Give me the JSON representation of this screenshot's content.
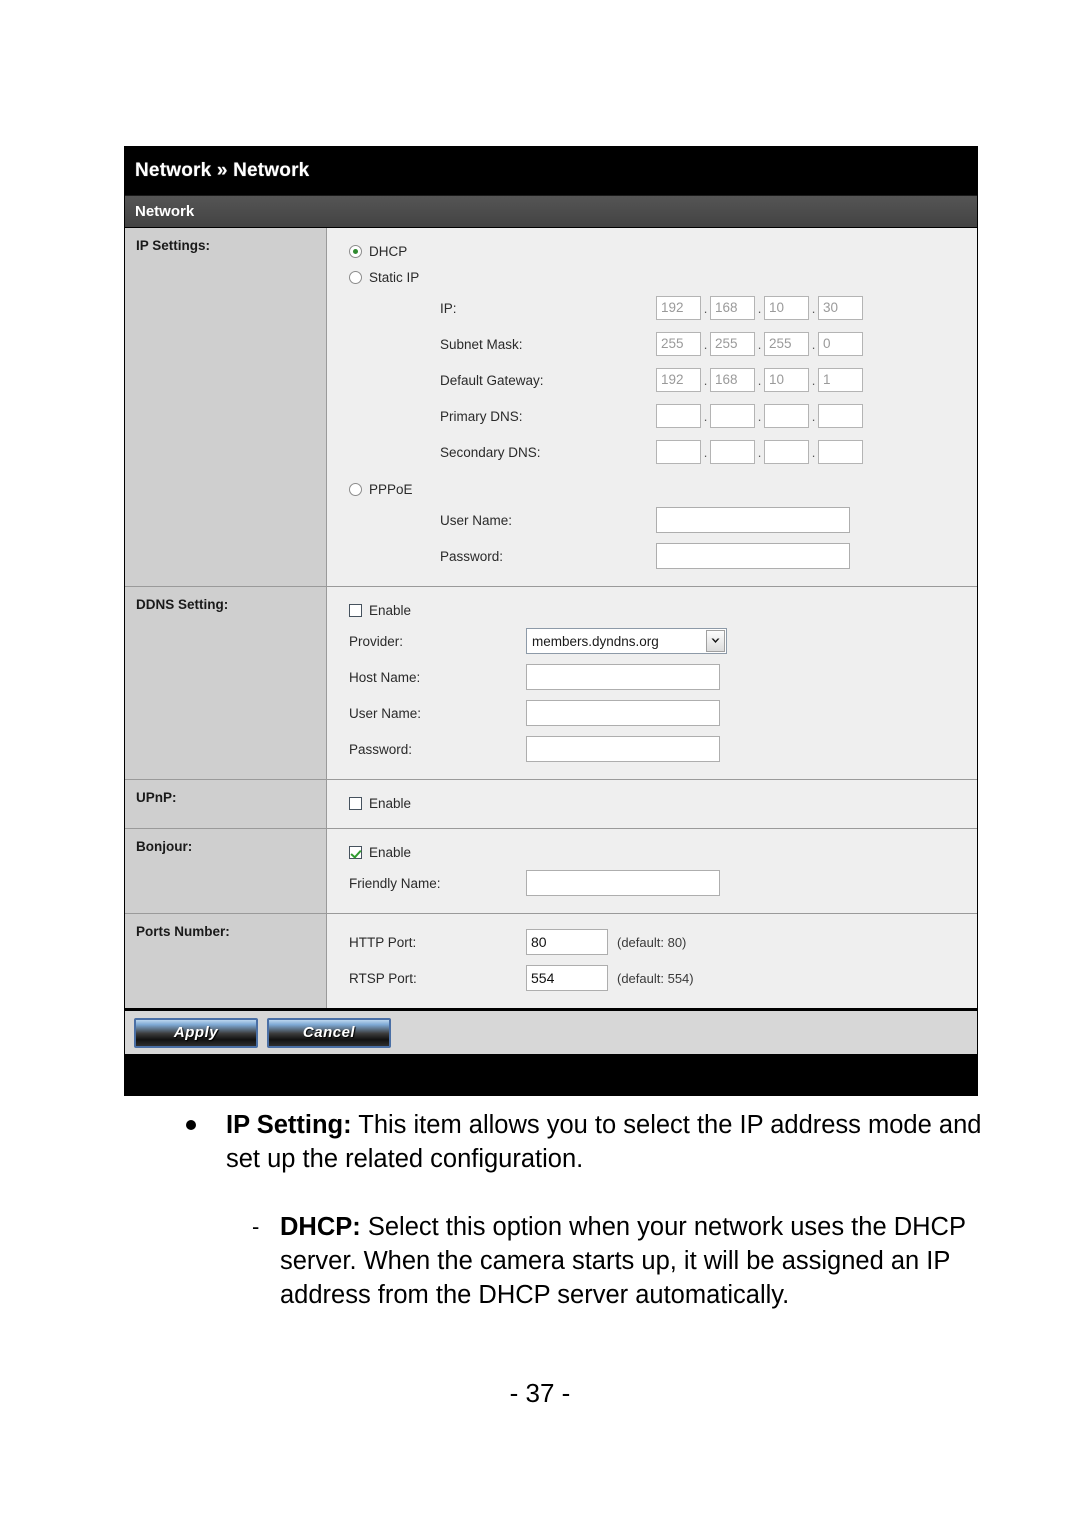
{
  "panel": {
    "breadcrumb": "Network » Network",
    "section_title": "Network",
    "rows": {
      "ip_settings": {
        "label": "IP Settings:",
        "dhcp_label": "DHCP",
        "dhcp_selected": true,
        "static_label": "Static IP",
        "static_selected": false,
        "fields": {
          "ip": {
            "label": "IP:",
            "octets": [
              "192",
              "168",
              "10",
              "30"
            ]
          },
          "subnet": {
            "label": "Subnet Mask:",
            "octets": [
              "255",
              "255",
              "255",
              "0"
            ]
          },
          "gateway": {
            "label": "Default Gateway:",
            "octets": [
              "192",
              "168",
              "10",
              "1"
            ]
          },
          "primary_dns": {
            "label": "Primary DNS:",
            "octets": [
              "",
              "",
              "",
              ""
            ]
          },
          "secondary_dns": {
            "label": "Secondary DNS:",
            "octets": [
              "",
              "",
              "",
              ""
            ]
          }
        },
        "pppoe_label": "PPPoE",
        "pppoe_selected": false,
        "pppoe_user_label": "User Name:",
        "pppoe_user_value": "",
        "pppoe_pass_label": "Password:",
        "pppoe_pass_value": ""
      },
      "ddns": {
        "label": "DDNS Setting:",
        "enable_label": "Enable",
        "enable_checked": false,
        "provider_label": "Provider:",
        "provider_value": "members.dyndns.org",
        "host_label": "Host Name:",
        "host_value": "",
        "user_label": "User Name:",
        "user_value": "",
        "pass_label": "Password:",
        "pass_value": ""
      },
      "upnp": {
        "label": "UPnP:",
        "enable_label": "Enable",
        "enable_checked": false
      },
      "bonjour": {
        "label": "Bonjour:",
        "enable_label": "Enable",
        "enable_checked": true,
        "friendly_label": "Friendly Name:",
        "friendly_value": ""
      },
      "ports": {
        "label": "Ports Number:",
        "http_label": "HTTP Port:",
        "http_value": "80",
        "http_default": "(default: 80)",
        "rtsp_label": "RTSP Port:",
        "rtsp_value": "554",
        "rtsp_default": "(default: 554)"
      }
    },
    "buttons": {
      "apply": "Apply",
      "cancel": "Cancel"
    }
  },
  "prose": {
    "bullet_title": "IP Setting:",
    "bullet_body": " This item allows you to select the IP address mode and set up the related configuration.",
    "sub_dash": "-",
    "sub_title": "DHCP:",
    "sub_body": " Select this option when your network uses the DHCP server. When the camera starts up, it will be assigned an IP address from the DHCP server automatically."
  },
  "page_number": "- 37 -",
  "colors": {
    "header_bg": "#000000",
    "section_bg": "#4c4c4c",
    "label_col_bg": "#cfcfcf",
    "field_bg": "#efefef",
    "checked_green": "#2f9b2f"
  }
}
